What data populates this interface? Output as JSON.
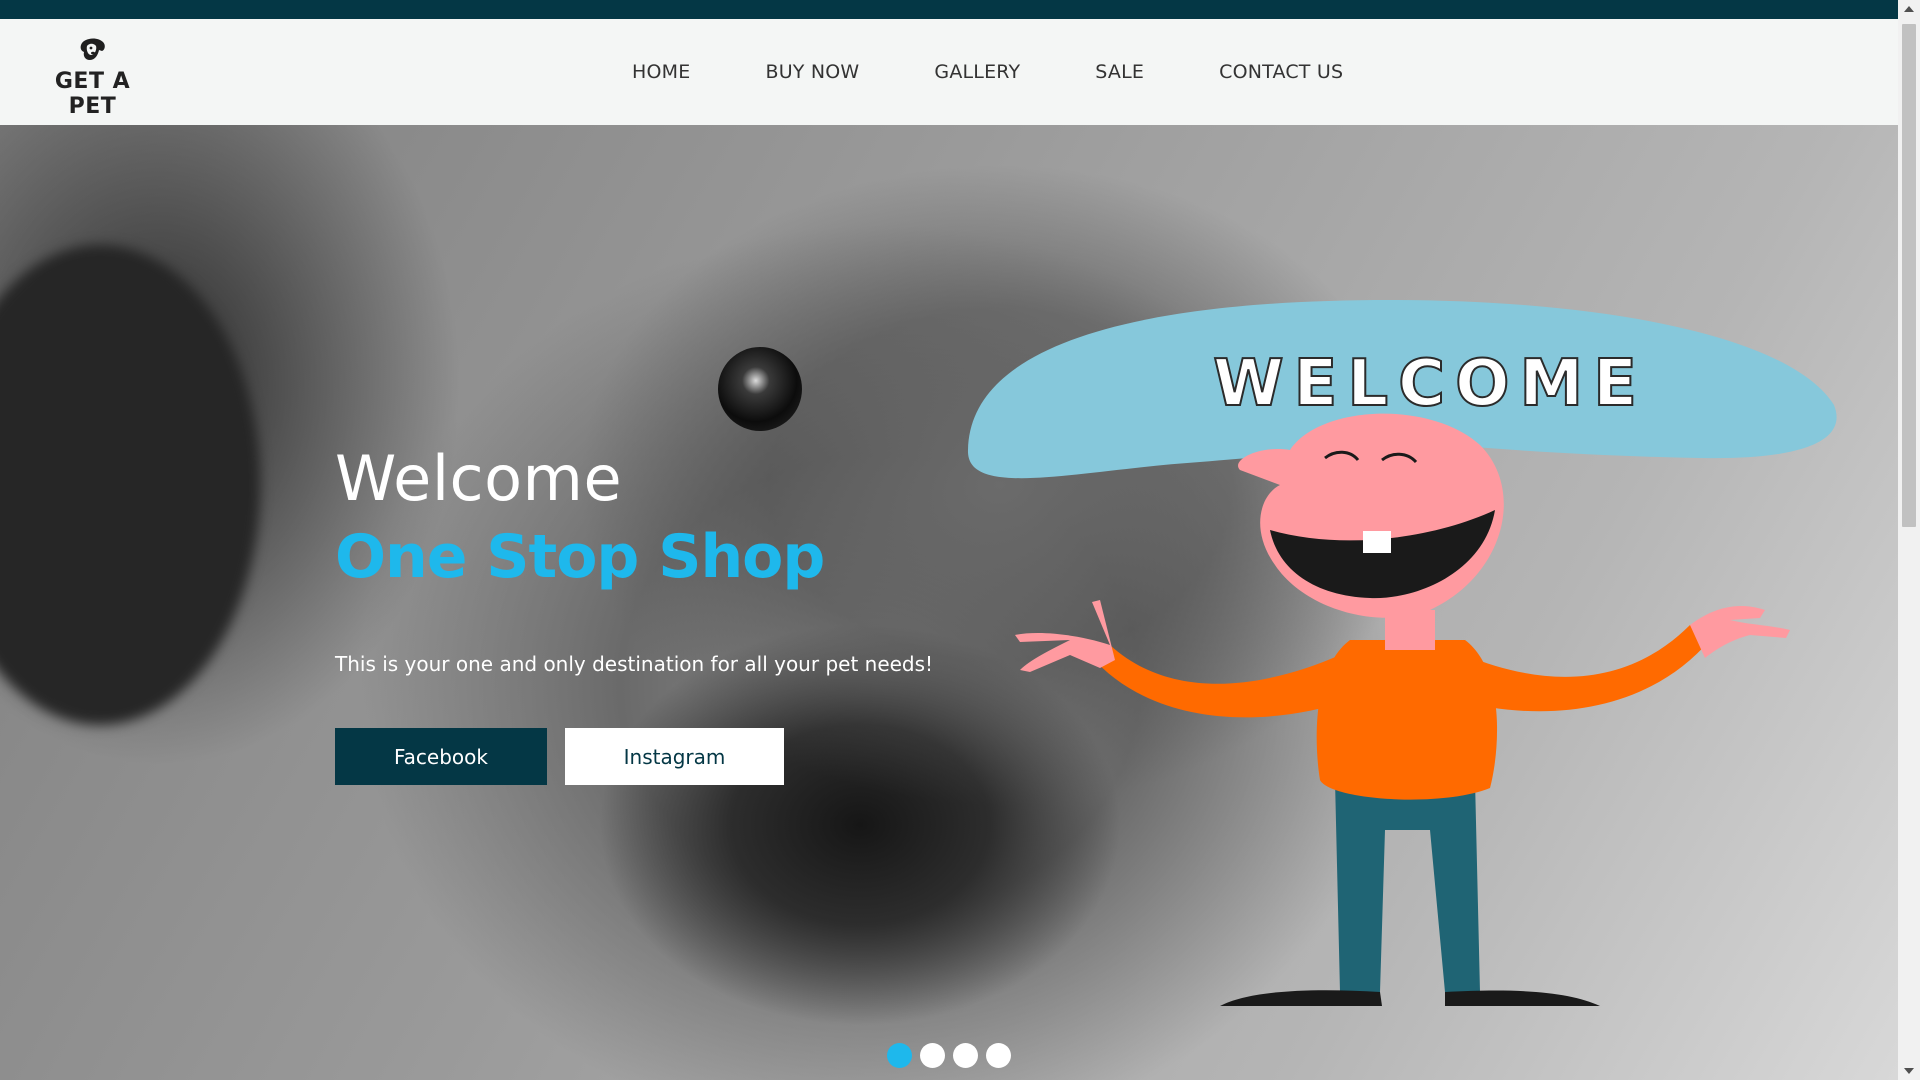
{
  "brand": {
    "name": "GET A PET",
    "logo_icon": "dog-head-icon"
  },
  "nav": {
    "items": [
      "HOME",
      "BUY NOW",
      "GALLERY",
      "SALE",
      "CONTACT US"
    ]
  },
  "hero": {
    "title": "Welcome",
    "tagline": "One Stop Shop",
    "subtitle": "This is your one and only destination for all your pet needs!",
    "buttons": {
      "facebook": "Facebook",
      "instagram": "Instagram"
    },
    "illustration": {
      "speech_text": "WELCOME"
    }
  },
  "carousel": {
    "slides": 4,
    "active": 1
  },
  "colors": {
    "primary": "#043745",
    "accent": "#1eb8ec",
    "header_bg": "#f4f6f5"
  }
}
